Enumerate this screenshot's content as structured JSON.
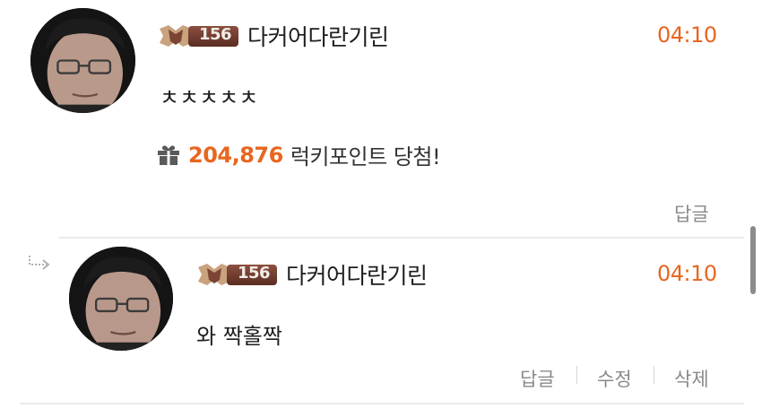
{
  "comment": {
    "level": "156",
    "nickname": "다커어다란기린",
    "time": "04:10",
    "text": "ㅊㅊㅊㅊㅊ",
    "lucky_points": "204,876",
    "lucky_text": "럭키포인트 당첨!",
    "reply_label": "답글"
  },
  "reply": {
    "level": "156",
    "nickname": "다커어다란기린",
    "time": "04:10",
    "text": "와 짝홀짝",
    "reply_label": "답글",
    "edit_label": "수정",
    "delete_label": "삭제"
  },
  "colors": {
    "accent": "#e8661f",
    "muted": "#8a8a8a",
    "divider": "#eaeaea"
  },
  "icons": [
    "rank-badge-icon",
    "gift-icon",
    "reply-arrow-icon"
  ]
}
